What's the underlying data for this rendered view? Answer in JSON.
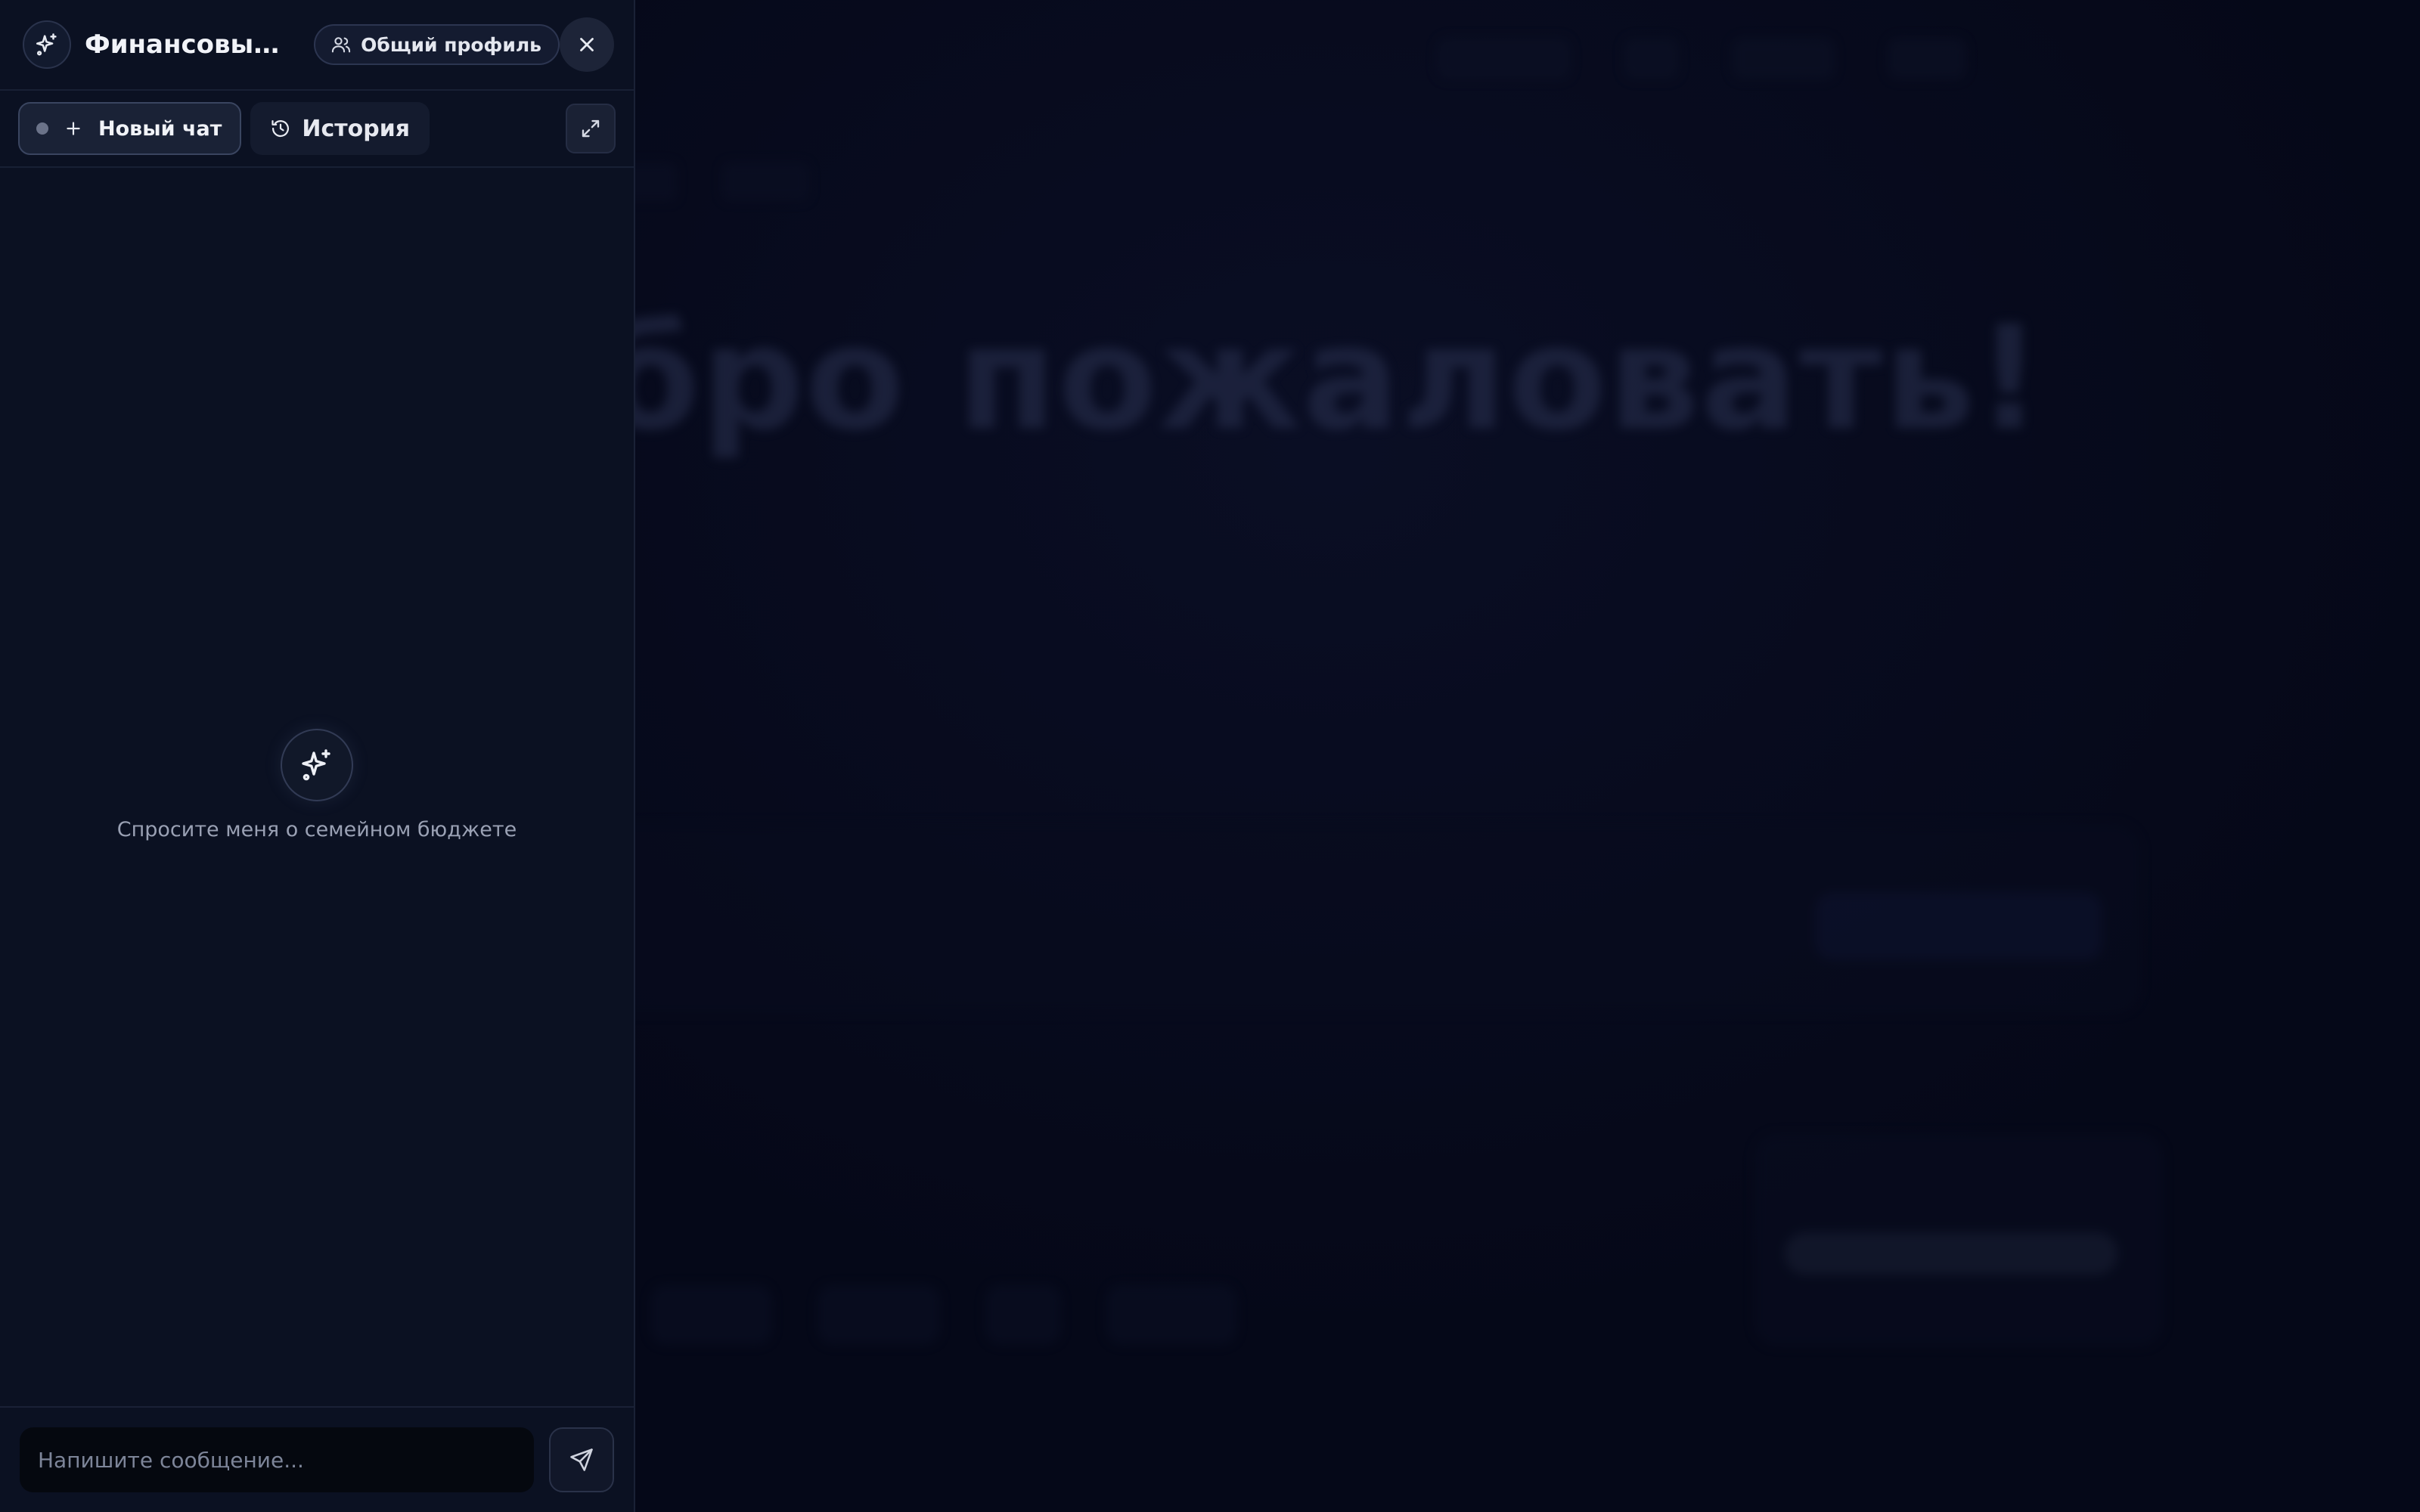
{
  "panel": {
    "title": "Финансовый кон...",
    "profile_chip_label": "Общий профиль",
    "new_chat_label": "Новый чат",
    "history_label": "История",
    "empty_state_text": "Спросите меня о семейном бюджете",
    "input_placeholder": "Напишите сообщение..."
  },
  "background": {
    "hero_text": "обро пожаловать!"
  },
  "icons": {
    "logo": "sparkles-icon",
    "profile": "users-icon",
    "close": "close-icon",
    "new_chat": "plus-icon",
    "history": "history-icon",
    "expand": "expand-icon",
    "empty_state": "sparkles-icon",
    "send": "send-icon"
  },
  "colors": {
    "panel_background": "#0b1122",
    "page_background": "#050818",
    "text_primary": "#f1f3f8",
    "text_muted": "#9aa1b4"
  }
}
